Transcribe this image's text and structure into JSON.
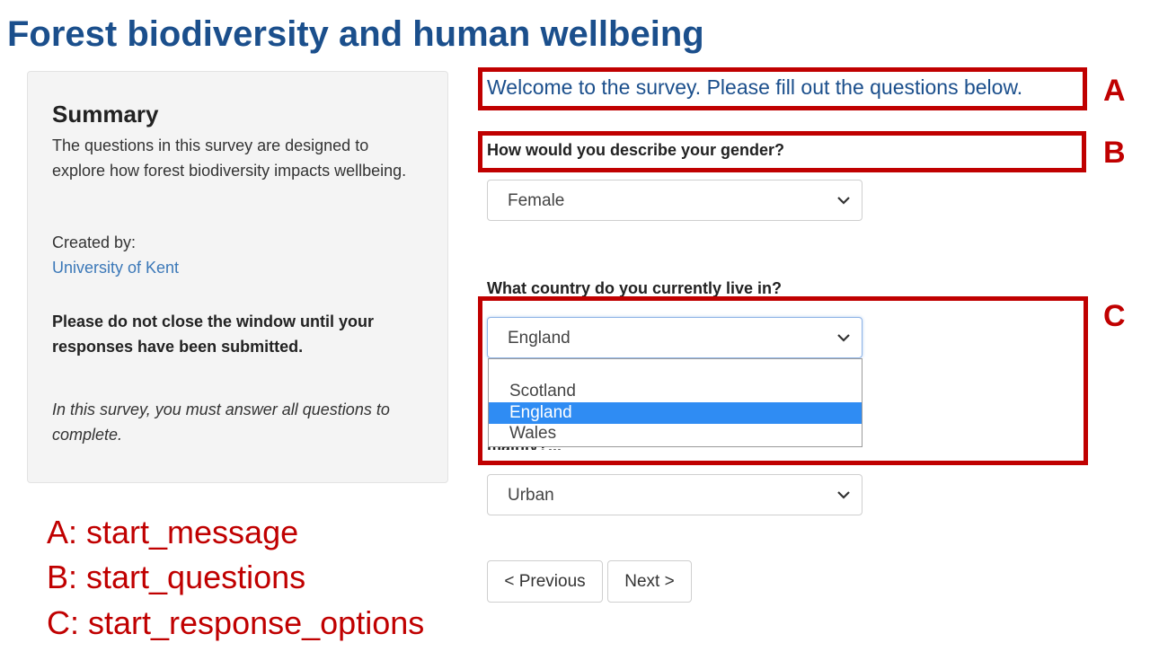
{
  "page_title": "Forest biodiversity and human wellbeing",
  "summary": {
    "title": "Summary",
    "description": "The questions in this survey are designed to explore how forest biodiversity impacts wellbeing.",
    "created_by_label": "Created by:",
    "created_by_link": "University of Kent",
    "warning": "Please do not close the window until your responses have been submitted.",
    "note": "In this survey, you must answer all questions to complete."
  },
  "survey": {
    "welcome": "Welcome to the survey. Please fill out the questions below.",
    "questions": [
      {
        "label": "How would you describe your gender?",
        "selected": "Female"
      },
      {
        "label": "What country do you currently live in?",
        "selected": "England",
        "open_options": [
          "Scotland",
          "England",
          "Wales"
        ],
        "highlighted_option": "England"
      },
      {
        "label": "mainly?...",
        "selected": "Urban"
      }
    ],
    "buttons": {
      "previous": "< Previous",
      "next": "Next >"
    }
  },
  "annotations": {
    "boxes": [
      "A",
      "B",
      "C"
    ],
    "legend": [
      "A: start_message",
      "B: start_questions",
      "C: start_response_options"
    ]
  },
  "colors": {
    "title_blue": "#1b4f8c",
    "link_blue": "#3b78b8",
    "annotation_red": "#c00000",
    "option_highlight": "#2f8cf3"
  },
  "icons": {
    "select_arrow": "chevron-down-icon"
  }
}
